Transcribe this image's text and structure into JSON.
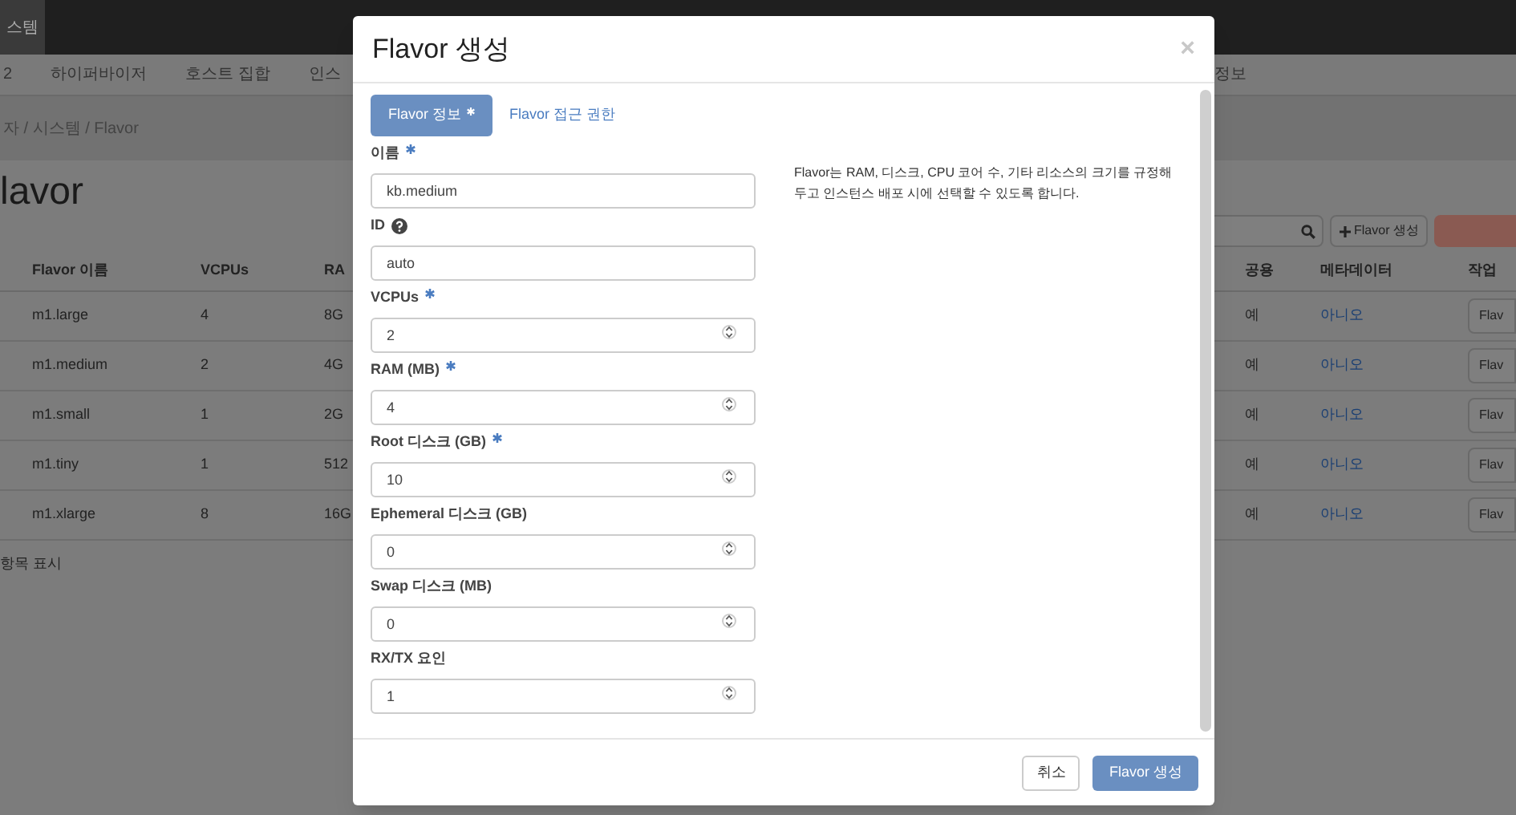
{
  "topbar": {
    "brand": "스템"
  },
  "nav": {
    "items": [
      "2",
      "하이퍼바이저",
      "호스트 집합",
      "인스"
    ],
    "right_item": "정보"
  },
  "breadcrumb": "자 / 시스템 / Flavor",
  "heading": "lavor",
  "toolbar": {
    "create_button": "Flavor 생성"
  },
  "table": {
    "columns_left": [
      "Flavor 이름",
      "VCPUs",
      "RA"
    ],
    "columns_right": [
      "공용",
      "메타데이터",
      "작업"
    ],
    "rows": [
      {
        "name": "m1.large",
        "vcpus": "4",
        "ram": "8G",
        "public": "예",
        "metadata": "아니오",
        "action": "Flav"
      },
      {
        "name": "m1.medium",
        "vcpus": "2",
        "ram": "4G",
        "public": "예",
        "metadata": "아니오",
        "action": "Flav"
      },
      {
        "name": "m1.small",
        "vcpus": "1",
        "ram": "2G",
        "public": "예",
        "metadata": "아니오",
        "action": "Flav"
      },
      {
        "name": "m1.tiny",
        "vcpus": "1",
        "ram": "512",
        "public": "예",
        "metadata": "아니오",
        "action": "Flav"
      },
      {
        "name": "m1.xlarge",
        "vcpus": "8",
        "ram": "16G",
        "public": "예",
        "metadata": "아니오",
        "action": "Flav"
      }
    ],
    "footer": "항목 표시"
  },
  "modal": {
    "title": "Flavor 생성",
    "close": "×",
    "tabs": [
      {
        "label": "Flavor 정보",
        "selected": true,
        "required": true
      },
      {
        "label": "Flavor 접근 권한",
        "selected": false,
        "required": false
      }
    ],
    "fields": [
      {
        "label": "이름",
        "required": true,
        "help": false,
        "kind": "text",
        "value": "kb.medium"
      },
      {
        "label": "ID",
        "required": false,
        "help": true,
        "kind": "text",
        "value": "auto"
      },
      {
        "label": "VCPUs",
        "required": true,
        "help": false,
        "kind": "number",
        "value": "2"
      },
      {
        "label": "RAM (MB)",
        "required": true,
        "help": false,
        "kind": "number",
        "value": "4"
      },
      {
        "label": "Root 디스크 (GB)",
        "required": true,
        "help": false,
        "kind": "number",
        "value": "10"
      },
      {
        "label": "Ephemeral 디스크 (GB)",
        "required": false,
        "help": false,
        "kind": "number",
        "value": "0"
      },
      {
        "label": "Swap 디스크 (MB)",
        "required": false,
        "help": false,
        "kind": "number",
        "value": "0"
      },
      {
        "label": "RX/TX 요인",
        "required": false,
        "help": false,
        "kind": "number",
        "value": "1"
      }
    ],
    "description": "Flavor는 RAM, 디스크, CPU 코어 수, 기타 리소스의 크기를 규정해 두고 인스턴스 배포 시에 선택할 수 있도록 합니다.",
    "buttons": [
      {
        "label": "취소",
        "kind": "default"
      },
      {
        "label": "Flavor 생성",
        "kind": "primary"
      }
    ]
  }
}
